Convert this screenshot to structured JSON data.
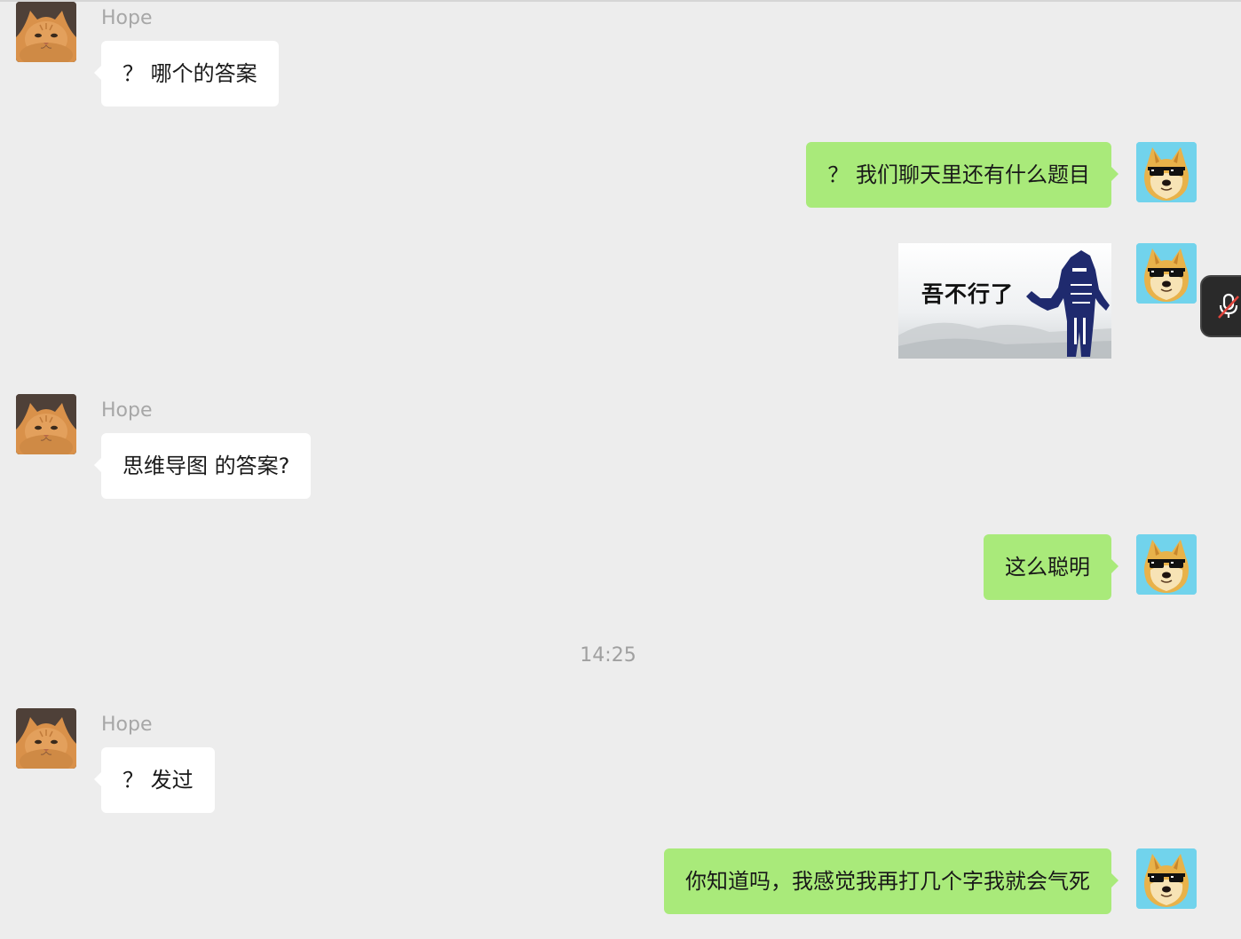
{
  "contact": {
    "name": "Hope"
  },
  "messages": [
    {
      "id": "m1",
      "direction": "incoming",
      "sender": "Hope",
      "text": "？ 哪个的答案"
    },
    {
      "id": "m2",
      "direction": "outgoing",
      "text": "？ 我们聊天里还有什么题目"
    },
    {
      "id": "m3",
      "direction": "outgoing",
      "type": "sticker",
      "sticker_text": "吾不行了"
    },
    {
      "id": "m4",
      "direction": "incoming",
      "sender": "Hope",
      "text": "思维导图 的答案?"
    },
    {
      "id": "m5",
      "direction": "outgoing",
      "text": "这么聪明"
    },
    {
      "id": "t1",
      "type": "timestamp",
      "text": "14:25"
    },
    {
      "id": "m6",
      "direction": "incoming",
      "sender": "Hope",
      "text": "？ 发过"
    },
    {
      "id": "m7",
      "direction": "outgoing",
      "text": "你知道吗，我感觉我再打几个字我就会气死"
    }
  ],
  "icons": {
    "incoming_avatar": "cat-avatar-icon",
    "outgoing_avatar": "doge-avatar-icon",
    "side_tab": "muted-microphone-icon"
  },
  "colors": {
    "background": "#ededed",
    "incoming_bubble": "#ffffff",
    "outgoing_bubble": "#a9ea7a",
    "sender_name": "#a7a7a7",
    "timestamp": "#a0a0a0"
  }
}
